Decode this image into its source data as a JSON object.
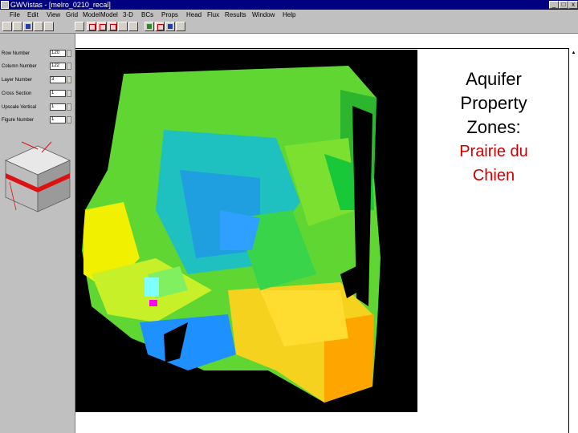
{
  "window": {
    "title": "GWVistas - [melro_0210_recal]",
    "controls": [
      "_",
      "□",
      "x"
    ]
  },
  "menubar": {
    "items": [
      "File",
      "Edit",
      "View",
      "Grid",
      "Model",
      "3-D",
      "BCs",
      "Props",
      "Head",
      "Flux",
      "Results",
      "Window",
      "Help"
    ]
  },
  "panel": {
    "fields": [
      {
        "label": "Row Number",
        "value": "120"
      },
      {
        "label": "Column Number",
        "value": "122"
      },
      {
        "label": "Layer Number",
        "value": "3"
      },
      {
        "label": "Cross Section",
        "value": "1"
      },
      {
        "label": "Upscale Vertical",
        "value": "1"
      },
      {
        "label": "Figure Number",
        "value": "1"
      }
    ]
  },
  "caption": {
    "line1": "Aquifer",
    "line2": "Property",
    "line3": "Zones:",
    "highlight_line1": "Prairie du",
    "highlight_line2": "Chien"
  },
  "colors": {
    "titlebar": "#000080",
    "chrome": "#c0c0c0",
    "highlight": "#cc0000"
  }
}
